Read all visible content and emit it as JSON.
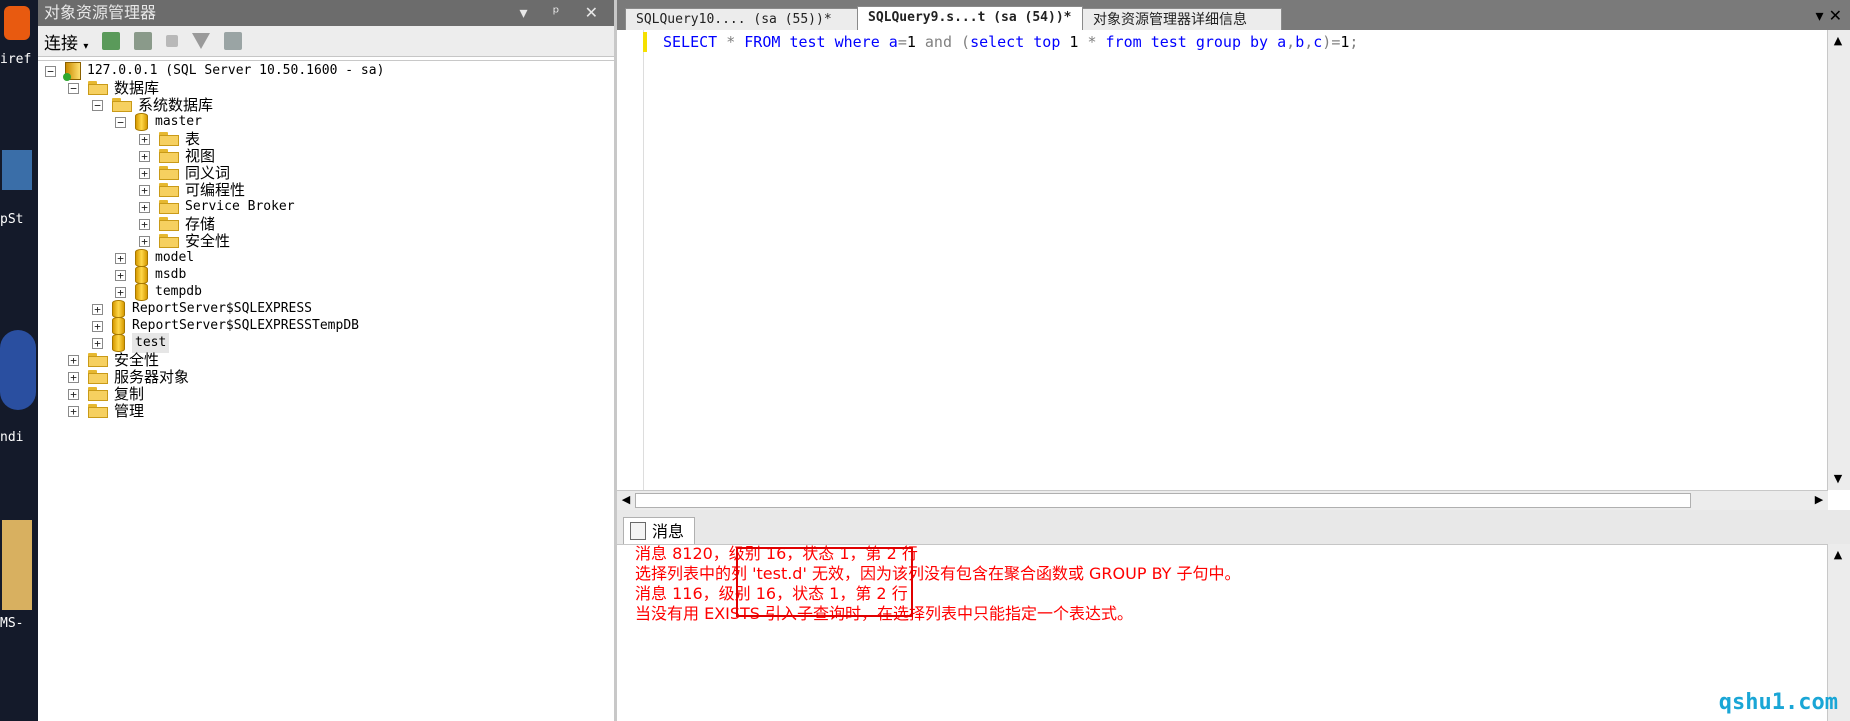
{
  "desktop": {
    "labels": [
      "iref",
      "pSt",
      "ndi",
      "MS-"
    ]
  },
  "object_explorer": {
    "title": "对象资源管理器",
    "title_buttons": "▾ ᵖ ✕",
    "toolbar": {
      "connect_label": "连接",
      "connect_caret": "▾"
    },
    "tree": {
      "server": "127.0.0.1 (SQL Server 10.50.1600 - sa)",
      "databases": "数据库",
      "system_databases": "系统数据库",
      "master": "master",
      "master_children": [
        "表",
        "视图",
        "同义词",
        "可编程性",
        "Service Broker",
        "存储",
        "安全性"
      ],
      "model": "model",
      "msdb": "msdb",
      "tempdb": "tempdb",
      "report_server": "ReportServer$SQLEXPRESS",
      "report_server_temp": "ReportServer$SQLEXPRESSTempDB",
      "test": "test",
      "top_level": [
        "安全性",
        "服务器对象",
        "复制",
        "管理"
      ]
    },
    "expand_collapsed": "+",
    "expand_open": "−"
  },
  "tabs": [
    {
      "label": "SQLQuery10.... (sa (55))*"
    },
    {
      "label": "SQLQuery9.s...t (sa (54))*"
    },
    {
      "label": "对象资源管理器详细信息"
    }
  ],
  "tab_controls": "▾ ✕",
  "editor": {
    "tokens": [
      {
        "t": "SELECT",
        "c": "kw"
      },
      {
        "t": " ",
        "c": "nm"
      },
      {
        "t": "*",
        "c": "op"
      },
      {
        "t": " ",
        "c": "nm"
      },
      {
        "t": "FROM",
        "c": "kw"
      },
      {
        "t": " ",
        "c": "nm"
      },
      {
        "t": "test",
        "c": "kw"
      },
      {
        "t": " ",
        "c": "nm"
      },
      {
        "t": "where",
        "c": "kw"
      },
      {
        "t": " a",
        "c": "kw"
      },
      {
        "t": "=",
        "c": "op"
      },
      {
        "t": "1",
        "c": "nm"
      },
      {
        "t": " ",
        "c": "nm"
      },
      {
        "t": "and",
        "c": "op"
      },
      {
        "t": " ",
        "c": "nm"
      },
      {
        "t": "(",
        "c": "op"
      },
      {
        "t": "select",
        "c": "kw"
      },
      {
        "t": " ",
        "c": "nm"
      },
      {
        "t": "top",
        "c": "kw"
      },
      {
        "t": " 1 ",
        "c": "nm"
      },
      {
        "t": "*",
        "c": "op"
      },
      {
        "t": " ",
        "c": "nm"
      },
      {
        "t": "from",
        "c": "kw"
      },
      {
        "t": " ",
        "c": "nm"
      },
      {
        "t": "test",
        "c": "kw"
      },
      {
        "t": " ",
        "c": "nm"
      },
      {
        "t": "group",
        "c": "kw"
      },
      {
        "t": " ",
        "c": "nm"
      },
      {
        "t": "by",
        "c": "kw"
      },
      {
        "t": " a",
        "c": "kw"
      },
      {
        "t": ",",
        "c": "op"
      },
      {
        "t": "b",
        "c": "kw"
      },
      {
        "t": ",",
        "c": "op"
      },
      {
        "t": "c",
        "c": "kw"
      },
      {
        "t": ")",
        "c": "op"
      },
      {
        "t": "=",
        "c": "op"
      },
      {
        "t": "1",
        "c": "nm"
      },
      {
        "t": ";",
        "c": "op"
      }
    ]
  },
  "results": {
    "tab_label": "消息",
    "messages": [
      "消息 8120，级别 16，状态 1，第 2 行",
      "选择列表中的列 'test.d' 无效，因为该列没有包含在聚合函数或 GROUP BY 子句中。",
      "消息 116，级别 16，状态 1，第 2 行",
      "当没有用 EXISTS 引入子查询时，在选择列表中只能指定一个表达式。"
    ]
  },
  "watermark": "qshu1.com",
  "colors": {
    "keyword": "#0000ff",
    "operator": "#808080",
    "error": "#ff0000",
    "watermark": "#1aa6d6"
  }
}
